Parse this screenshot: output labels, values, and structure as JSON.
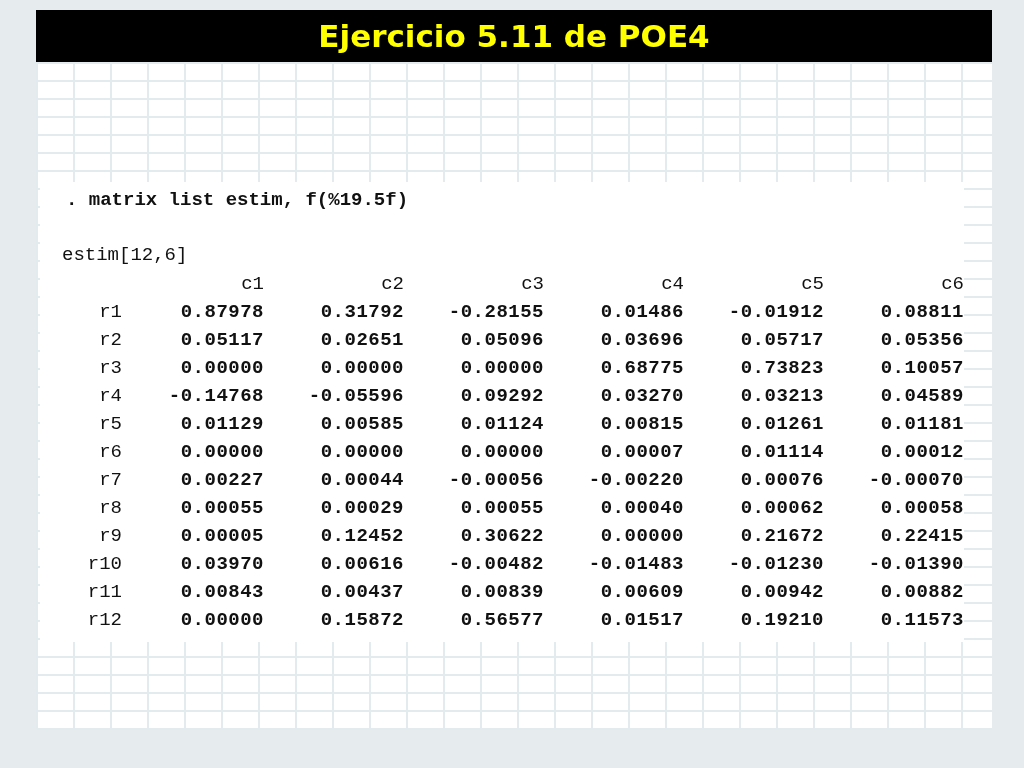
{
  "title": "Ejercicio 5.11 de POE4",
  "output": {
    "command": ". matrix list estim, f(%19.5f)",
    "matrix_name": "estim[12,6]",
    "columns": [
      "c1",
      "c2",
      "c3",
      "c4",
      "c5",
      "c6"
    ],
    "rows": [
      {
        "label": "r1",
        "values": [
          "0.87978",
          "0.31792",
          "-0.28155",
          "0.01486",
          "-0.01912",
          "0.08811"
        ]
      },
      {
        "label": "r2",
        "values": [
          "0.05117",
          "0.02651",
          "0.05096",
          "0.03696",
          "0.05717",
          "0.05356"
        ]
      },
      {
        "label": "r3",
        "values": [
          "0.00000",
          "0.00000",
          "0.00000",
          "0.68775",
          "0.73823",
          "0.10057"
        ]
      },
      {
        "label": "r4",
        "values": [
          "-0.14768",
          "-0.05596",
          "0.09292",
          "0.03270",
          "0.03213",
          "0.04589"
        ]
      },
      {
        "label": "r5",
        "values": [
          "0.01129",
          "0.00585",
          "0.01124",
          "0.00815",
          "0.01261",
          "0.01181"
        ]
      },
      {
        "label": "r6",
        "values": [
          "0.00000",
          "0.00000",
          "0.00000",
          "0.00007",
          "0.01114",
          "0.00012"
        ]
      },
      {
        "label": "r7",
        "values": [
          "0.00227",
          "0.00044",
          "-0.00056",
          "-0.00220",
          "0.00076",
          "-0.00070"
        ]
      },
      {
        "label": "r8",
        "values": [
          "0.00055",
          "0.00029",
          "0.00055",
          "0.00040",
          "0.00062",
          "0.00058"
        ]
      },
      {
        "label": "r9",
        "values": [
          "0.00005",
          "0.12452",
          "0.30622",
          "0.00000",
          "0.21672",
          "0.22415"
        ]
      },
      {
        "label": "r10",
        "values": [
          "0.03970",
          "0.00616",
          "-0.00482",
          "-0.01483",
          "-0.01230",
          "-0.01390"
        ]
      },
      {
        "label": "r11",
        "values": [
          "0.00843",
          "0.00437",
          "0.00839",
          "0.00609",
          "0.00942",
          "0.00882"
        ]
      },
      {
        "label": "r12",
        "values": [
          "0.00000",
          "0.15872",
          "0.56577",
          "0.01517",
          "0.19210",
          "0.11573"
        ]
      }
    ]
  }
}
